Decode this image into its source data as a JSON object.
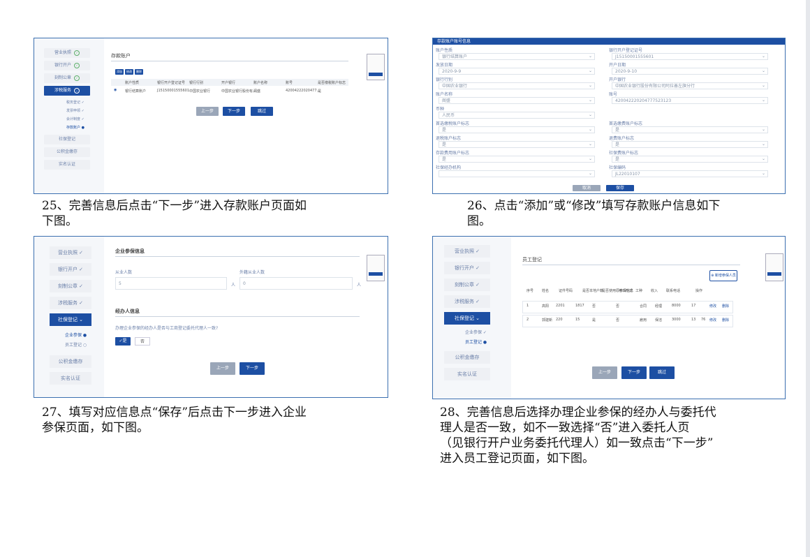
{
  "captions": {
    "step25": [
      "25、完善信息后点击“下一步”进入存款账户页面如",
      "下图。"
    ],
    "step26": [
      "26、点击“添加”或“修改”填写存款账户信息如下",
      "图。"
    ],
    "step27": [
      "27、填写对应信息点“保存”后点击下一步进入企业",
      "参保页面，如下图。"
    ],
    "step28": [
      "28、完善信息后选择办理企业参保的经办人与委托代",
      "理人是否一致，如不一致选择“否”进入委托人页",
      "（见银行开户业务委托代理人）如一致点击“下一步”",
      "进入员工登记页面，如下图。"
    ]
  },
  "panel1": {
    "sidebar": [
      "营业执照",
      "银行开户",
      "刻制公章",
      "涉税服务",
      "社保登记",
      "公积金缴存",
      "实名认证"
    ],
    "subitems": [
      "税务登记",
      "发票申领",
      "会计制度",
      "存款账户"
    ],
    "section_title": "存款账户",
    "buttons": [
      "添加",
      "修改",
      "删除"
    ],
    "headers": [
      "账户性质",
      "银行开户登记证号",
      "银行行别",
      "开户银行",
      "账户名称",
      "账号",
      "是否缴税账户标志"
    ],
    "row": [
      "银行结算账户",
      "J15150001555601",
      "中国农业银行",
      "中国农业银行股份有...",
      "阁盛",
      "42004222020477...",
      "是"
    ],
    "nav": [
      "上一步",
      "下一步",
      "跳过"
    ]
  },
  "panel2": {
    "header": "存款账户账号信息",
    "fields": [
      {
        "label": "账户性质",
        "value": "银行结算账户"
      },
      {
        "label": "银行开户登记证号",
        "value": "J15150001555601"
      },
      {
        "label": "发放日期",
        "value": "2020-9-9"
      },
      {
        "label": "开户日期",
        "value": "2020-9-10"
      },
      {
        "label": "银行行别",
        "value": "中国农业银行"
      },
      {
        "label": "开户银行",
        "value": "中国农业银行股份有限公司阿拉善左旗分行"
      },
      {
        "label": "账户名称",
        "value": "阁盛"
      },
      {
        "label": "账号",
        "value": "420042220204777523123"
      },
      {
        "label": "币种",
        "value": "人民币"
      },
      {
        "label": "首选缴税账户标志",
        "value": ""
      },
      {
        "label": "首选缴费账户标志",
        "value": ""
      },
      {
        "label": "退税账户标志",
        "value": ""
      },
      {
        "label": "退费账户标志",
        "value": ""
      },
      {
        "label": "存款费用账户标志",
        "value": ""
      },
      {
        "label": "社保费账户标志",
        "value": ""
      },
      {
        "label": "社保经办机构",
        "value": ""
      },
      {
        "label": "社保编码",
        "value": "JL22010107"
      }
    ],
    "yes": "是",
    "buttons": [
      "取消",
      "保存"
    ]
  },
  "panel3": {
    "sidebar": [
      "营业执照",
      "银行开户",
      "刻制公章",
      "涉税服务",
      "社保登记",
      "公积金缴存",
      "实名认证"
    ],
    "subitems": [
      "企业参保",
      "员工登记"
    ],
    "section1": "企业参保信息",
    "label_a": "从业人数",
    "label_b": "外籍从业人数",
    "value_a": "5",
    "value_b": "0",
    "unit": "人",
    "section2": "经办人信息",
    "question": "办理企业参保的经办人是否与工商登记委托代理人一致?",
    "yes": "是",
    "no": "否",
    "nav": [
      "上一步",
      "下一步"
    ]
  },
  "panel4": {
    "sidebar": [
      "营业执照",
      "银行开户",
      "刻制公章",
      "涉税服务",
      "社保登记",
      "公积金缴存",
      "实名认证"
    ],
    "subitems": [
      "企业参保",
      "员工登记"
    ],
    "section_title": "员工登记",
    "add_button": "新增参保人员",
    "headers": [
      "序号",
      "姓名",
      "证件号码",
      "是否本地户籍",
      "是否使用原参保信息",
      "用工形式",
      "工种",
      "收入",
      "联系电话",
      "操作"
    ],
    "rows": [
      [
        "1",
        "高阳",
        "2201",
        "1817",
        "否",
        "否",
        "合同",
        "经理",
        "8000",
        "17",
        "修改",
        "删除"
      ],
      [
        "2",
        "郭建新",
        "220",
        "15",
        "是",
        "否",
        "雇用",
        "保洁",
        "3000",
        "13",
        "76",
        "修改",
        "删除"
      ]
    ],
    "nav": [
      "上一步",
      "下一步",
      "跳过"
    ]
  }
}
